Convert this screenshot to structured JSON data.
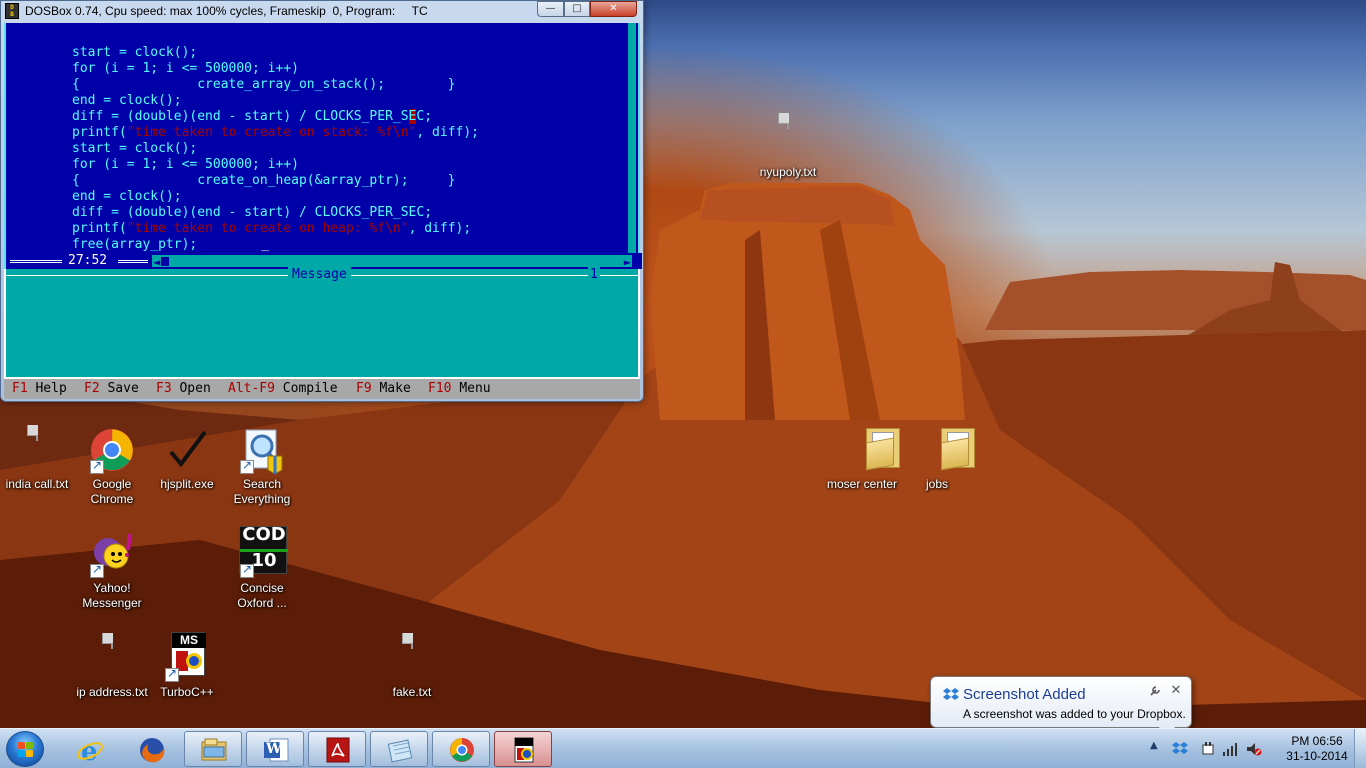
{
  "dosbox": {
    "title": "DOSBox 0.74, Cpu speed: max 100% cycles, Frameskip  0, Program:     TC",
    "app_icon_text": "DOS\nBOX",
    "minimize": "—",
    "maximize": "□",
    "close": "✕"
  },
  "editor": {
    "lines": [
      "start = clock();",
      "for (i = 1; i <= 500000; i++)",
      "{               create_array_on_stack();        }",
      "end = clock();",
      "diff = (double)(end - start) / CLOCKS_PER_S",
      "printf(",
      "start = clock();",
      "for (i = 1; i <= 500000; i++)",
      "{               create_on_heap(&array_ptr);     }",
      "end = clock();",
      "diff = (double)(end - start) / CLOCKS_PER_SEC;",
      "printf(",
      "free(array_ptr);"
    ],
    "line5_cursor_char": "E",
    "line5_rest": "C;",
    "line6_string": "\"time taken to create on stack: %f\\n\"",
    "line6_rest": ", diff);",
    "line12_string": "\"time taken to create on heap: %f\\n\"",
    "line12_rest": ", diff);",
    "cursor_position": "27:52",
    "bottom_cursor": "_"
  },
  "message_pane": {
    "title": "Message",
    "number": "1"
  },
  "fkeys": [
    {
      "key": "F1",
      "label": "Help"
    },
    {
      "key": "F2",
      "label": "Save"
    },
    {
      "key": "F3",
      "label": "Open"
    },
    {
      "key": "Alt-F9",
      "label": "Compile"
    },
    {
      "key": "F9",
      "label": "Make"
    },
    {
      "key": "F10",
      "label": "Menu"
    }
  ],
  "desktop_icons": {
    "nyupoly": "nyupoly.txt",
    "india_call": "india call.txt",
    "chrome": "Google Chrome",
    "hjsplit": "hjsplit.exe",
    "search_everything": "Search Everything",
    "yahoo": "Yahoo! Messenger",
    "concise_oxford": "Concise Oxford ...",
    "cod_badge_top": "COD",
    "cod_badge_num": "10",
    "ip_address": "ip address.txt",
    "turbocpp": "TurboC++",
    "turbo_badge": "MS",
    "fake": "fake.txt",
    "moser_center": "moser center",
    "jobs": "jobs"
  },
  "notification": {
    "title": "Screenshot Added",
    "body": "A screenshot was added to your Dropbox."
  },
  "taskbar": {
    "clock_time": "PM 06:56",
    "clock_date": "31-10-2014",
    "word_letter": "W",
    "tray_expand": "▲"
  },
  "colors": {
    "editor_bg": "#0000a8",
    "code_text": "#55ffff",
    "string_text": "#a80000",
    "message_bg": "#00a8a8",
    "fkey_bar": "#a8a8a8"
  }
}
